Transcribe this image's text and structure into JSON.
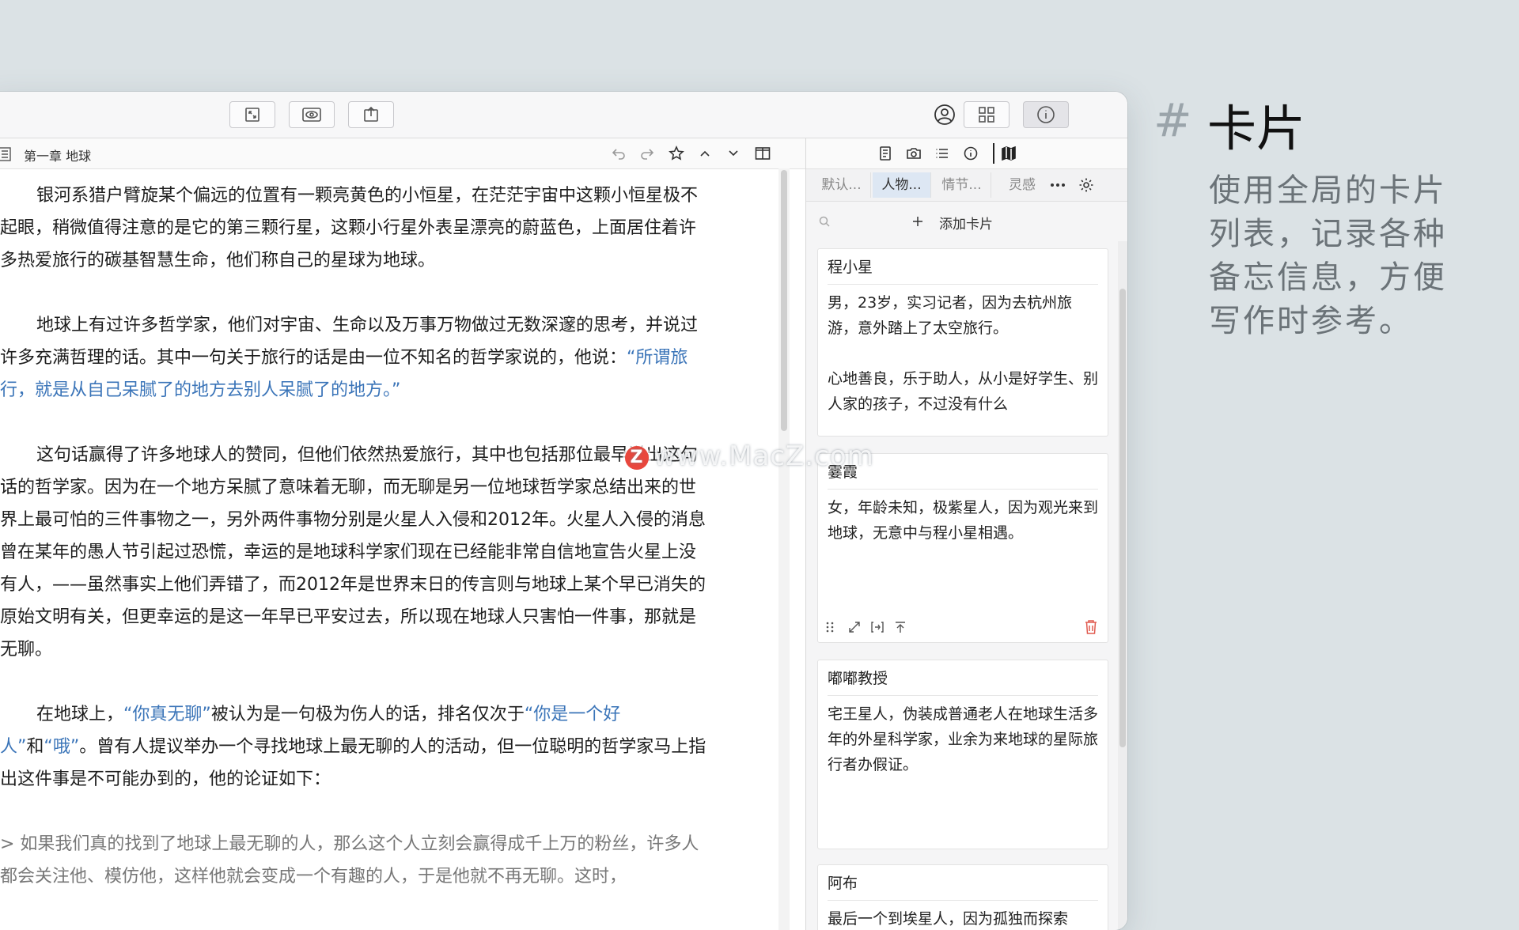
{
  "marketing": {
    "hash": "#",
    "title": "卡片",
    "description": "使用全局的卡片列表，记录各种备忘信息，方便写作时参考。"
  },
  "editor": {
    "doc_title": "第一章 地球",
    "paragraphs": {
      "p1": "银河系猎户臂旋某个偏远的位置有一颗亮黄色的小恒星，在茫茫宇宙中这颗小恒星极不起眼，稍微值得注意的是它的第三颗行星，这颗小行星外表呈漂亮的蔚蓝色，上面居住着许多热爱旅行的碳基智慧生命，他们称自己的星球为地球。",
      "p2_a": "地球上有过许多哲学家，他们对宇宙、生命以及万事万物做过无数深邃的思考，并说过许多充满哲理的话。其中一句关于旅行的话是由一位不知名的哲学家说的，他说：",
      "p2_q": "“所谓旅行，就是从自己呆腻了的地方去别人呆腻了的地方。”",
      "p3": "这句话赢得了许多地球人的赞同，但他们依然热爱旅行，其中也包括那位最早说出这句话的哲学家。因为在一个地方呆腻了意味着无聊，而无聊是另一位地球哲学家总结出来的世界上最可怕的三件事物之一，另外两件事物分别是火星人入侵和2012年。火星人入侵的消息曾在某年的愚人节引起过恐慌，幸运的是地球科学家们现在已经能非常自信地宣告火星上没有人，——虽然事实上他们弄错了，而2012年是世界末日的传言则与地球上某个早已消失的原始文明有关，但更幸运的是这一年早已平安过去，所以现在地球人只害怕一件事，那就是无聊。",
      "p4_a": "在地球上，",
      "p4_q1": "“你真无聊”",
      "p4_b": "被认为是一句极为伤人的话，排名仅次于",
      "p4_q2": "“你是一个好人”",
      "p4_c": "和",
      "p4_q3": "“哦”",
      "p4_d": "。曾有人提议举办一个寻找地球上最无聊的人的活动，但一位聪明的哲学家马上指出这件事是不可能办到的，他的论证如下：",
      "p5": "> 如果我们真的找到了地球上最无聊的人，那么这个人立刻会赢得成千上万的粉丝，许多人都会关注他、模仿他，这样他就会变成一个有趣的人，于是他就不再无聊。这时，"
    }
  },
  "panel": {
    "tabs": [
      "默认...",
      "人物...",
      "情节...",
      "灵感"
    ],
    "active_tab": "人物...",
    "add_card_label": "添加卡片",
    "cards": [
      {
        "title": "程小星",
        "body": "男，23岁，实习记者，因为去杭州旅游，意外踏上了太空旅行。\n\n心地善良，乐于助人，从小是好学生、别人家的孩子，不过没有什么"
      },
      {
        "title": "霎霞",
        "body": "女，年龄未知，极紫星人，因为观光来到地球，无意中与程小星相遇。"
      },
      {
        "title": "嘟嘟教授",
        "body": "宅王星人，伪装成普通老人在地球生活多年的外星科学家，业余为来地球的星际旅行者办假证。"
      },
      {
        "title": "阿布",
        "body": "最后一个到埃星人，因为孤独而探索"
      }
    ]
  },
  "watermark": {
    "badge": "Z",
    "text": "www.MacZ.com"
  },
  "colors": {
    "background": "#dbe2e5",
    "link_blue": "#3a74b8",
    "active_tab": "#dde7f3",
    "trash_red": "#e05a4f"
  }
}
